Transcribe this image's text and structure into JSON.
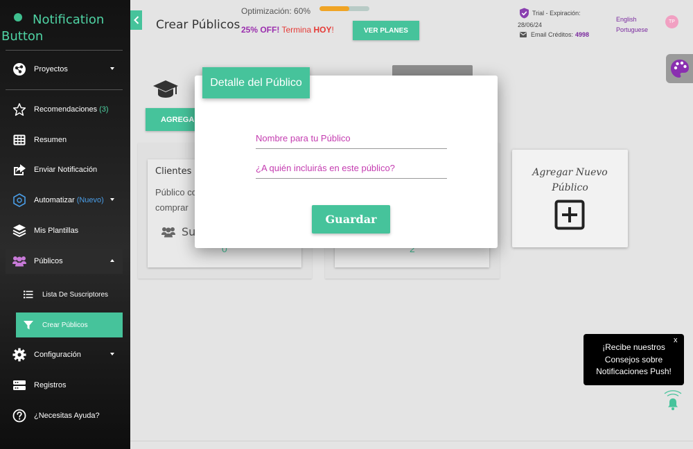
{
  "brand": {
    "line1": "Notification",
    "line2": "Button"
  },
  "colors": {
    "accent": "#46c39b",
    "purple": "#7a2a9e",
    "promo_red": "#e53935",
    "progress": "#f0a425"
  },
  "sidebar": {
    "projects": {
      "label": "Proyectos",
      "icon": "projects-icon"
    },
    "items": [
      {
        "label": "Recomendaciones",
        "badge": "(3)",
        "icon": "star-icon"
      },
      {
        "label": "Resumen",
        "icon": "grid-icon"
      },
      {
        "label": "Enviar Notificación",
        "icon": "share-icon"
      },
      {
        "label": "Automatizar",
        "badge": "(Nuevo)",
        "icon": "automation-icon"
      },
      {
        "label": "Mis Plantillas",
        "icon": "layers-icon"
      },
      {
        "label": "Públicos",
        "icon": "users-icon"
      },
      {
        "label": "Configuración",
        "icon": "gear-icon"
      },
      {
        "label": "Registros",
        "icon": "server-icon"
      },
      {
        "label": "¿Necesitas Ayuda?",
        "icon": "help-icon"
      }
    ],
    "subitems": [
      {
        "label": "Lista De Suscriptores",
        "icon": "list-icon"
      },
      {
        "label": "Crear Públicos",
        "icon": "filter-icon"
      }
    ]
  },
  "header": {
    "title": "Crear Públicos",
    "optimization_label": "Optimización: 60%",
    "optimization_value": 0.6,
    "promo_off": "25% OFF!",
    "promo_ends": "Termina",
    "promo_today": "HOY",
    "promo_bang": "!",
    "plans_button": "VER PLANES",
    "trial_label": "Trial - Expiración:",
    "expiration_date": "28/06/24",
    "credits_label": "Email Créditos:",
    "credits_value": "4998",
    "lang_english": "English",
    "lang_portuguese": "Portuguese",
    "avatar_initials": "TP"
  },
  "main": {
    "add_button": "AGREGAR",
    "card1": {
      "title": "Clientes F",
      "desc_line1": "Público co",
      "desc_line2": "comprar",
      "stat_label": "Su",
      "count": "0"
    },
    "card2": {
      "count": "2"
    },
    "add_card": {
      "line1": "Agregar Nuevo",
      "line2": "Público"
    }
  },
  "modal": {
    "title": "Detalle del Público",
    "name_placeholder": "Nombre para tu Público",
    "who_placeholder": "¿A quién incluirás en este público?",
    "save_button": "Guardar"
  },
  "tooltip": {
    "line1": "¡Recibe nuestros",
    "line2": "Consejos sobre",
    "line3": "Notificaciones Push!",
    "close": "x"
  }
}
